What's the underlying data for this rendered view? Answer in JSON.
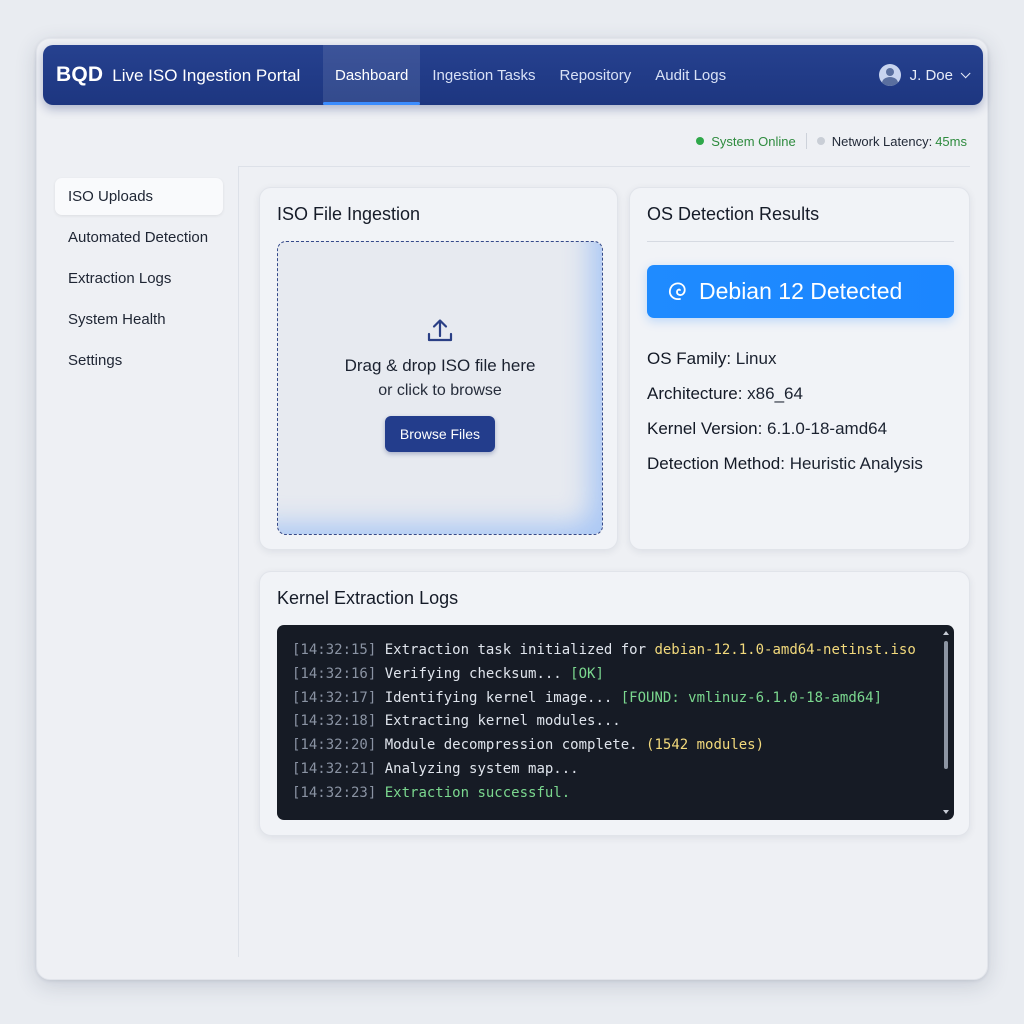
{
  "header": {
    "logo": "BQD",
    "title": "Live ISO Ingestion Portal",
    "nav": [
      {
        "label": "Dashboard",
        "active": true
      },
      {
        "label": "Ingestion Tasks",
        "active": false
      },
      {
        "label": "Repository",
        "active": false
      },
      {
        "label": "Audit Logs",
        "active": false
      }
    ],
    "user": "J. Doe"
  },
  "status": {
    "online": "System Online",
    "latency_label": "Network Latency:",
    "latency_value": "45ms",
    "online_color": "#2e8b3e"
  },
  "sidebar": {
    "items": [
      {
        "label": "ISO Uploads",
        "active": true
      },
      {
        "label": "Automated Detection",
        "active": false
      },
      {
        "label": "Extraction Logs",
        "active": false
      },
      {
        "label": "System Health",
        "active": false
      },
      {
        "label": "Settings",
        "active": false
      }
    ]
  },
  "upload": {
    "title": "ISO File Ingestion",
    "drop_main": "Drag & drop ISO file here",
    "drop_sub": "or click to browse",
    "button": "Browse Files",
    "icon": "upload-icon"
  },
  "detection": {
    "title": "OS Detection Results",
    "badge": "Debian 12 Detected",
    "badge_icon": "debian-swirl-icon",
    "badge_color": "#1f8bff",
    "fields": [
      {
        "label": "OS Family:",
        "value": "Linux"
      },
      {
        "label": "Architecture:",
        "value": "x86_64"
      },
      {
        "label": "Kernel Version:",
        "value": "6.1.0-18-amd64"
      },
      {
        "label": "Detection Method:",
        "value": "Heuristic Analysis"
      }
    ]
  },
  "logs": {
    "title": "Kernel Extraction Logs",
    "lines": [
      {
        "ts": "[14:32:15]",
        "text": "Extraction task initialized for ",
        "hl": "debian-12.1.0-amd64-netinst.iso",
        "hl_color": "yellow"
      },
      {
        "ts": "[14:32:16]",
        "text": "Verifying checksum... ",
        "hl": "[OK]",
        "hl_color": "green"
      },
      {
        "ts": "[14:32:17]",
        "text": "Identifying kernel image... ",
        "hl": "[FOUND: vmlinuz-6.1.0-18-amd64]",
        "hl_color": "green"
      },
      {
        "ts": "[14:32:18]",
        "text": "Extracting kernel modules...",
        "hl": "",
        "hl_color": ""
      },
      {
        "ts": "[14:32:20]",
        "text": "Module decompression complete. ",
        "hl": "(1542 modules)",
        "hl_color": "yellow"
      },
      {
        "ts": "[14:32:21]",
        "text": "Analyzing system map...",
        "hl": "",
        "hl_color": ""
      },
      {
        "ts": "[14:32:23]",
        "text": "",
        "hl": "Extraction successful.",
        "hl_color": "green"
      }
    ]
  }
}
